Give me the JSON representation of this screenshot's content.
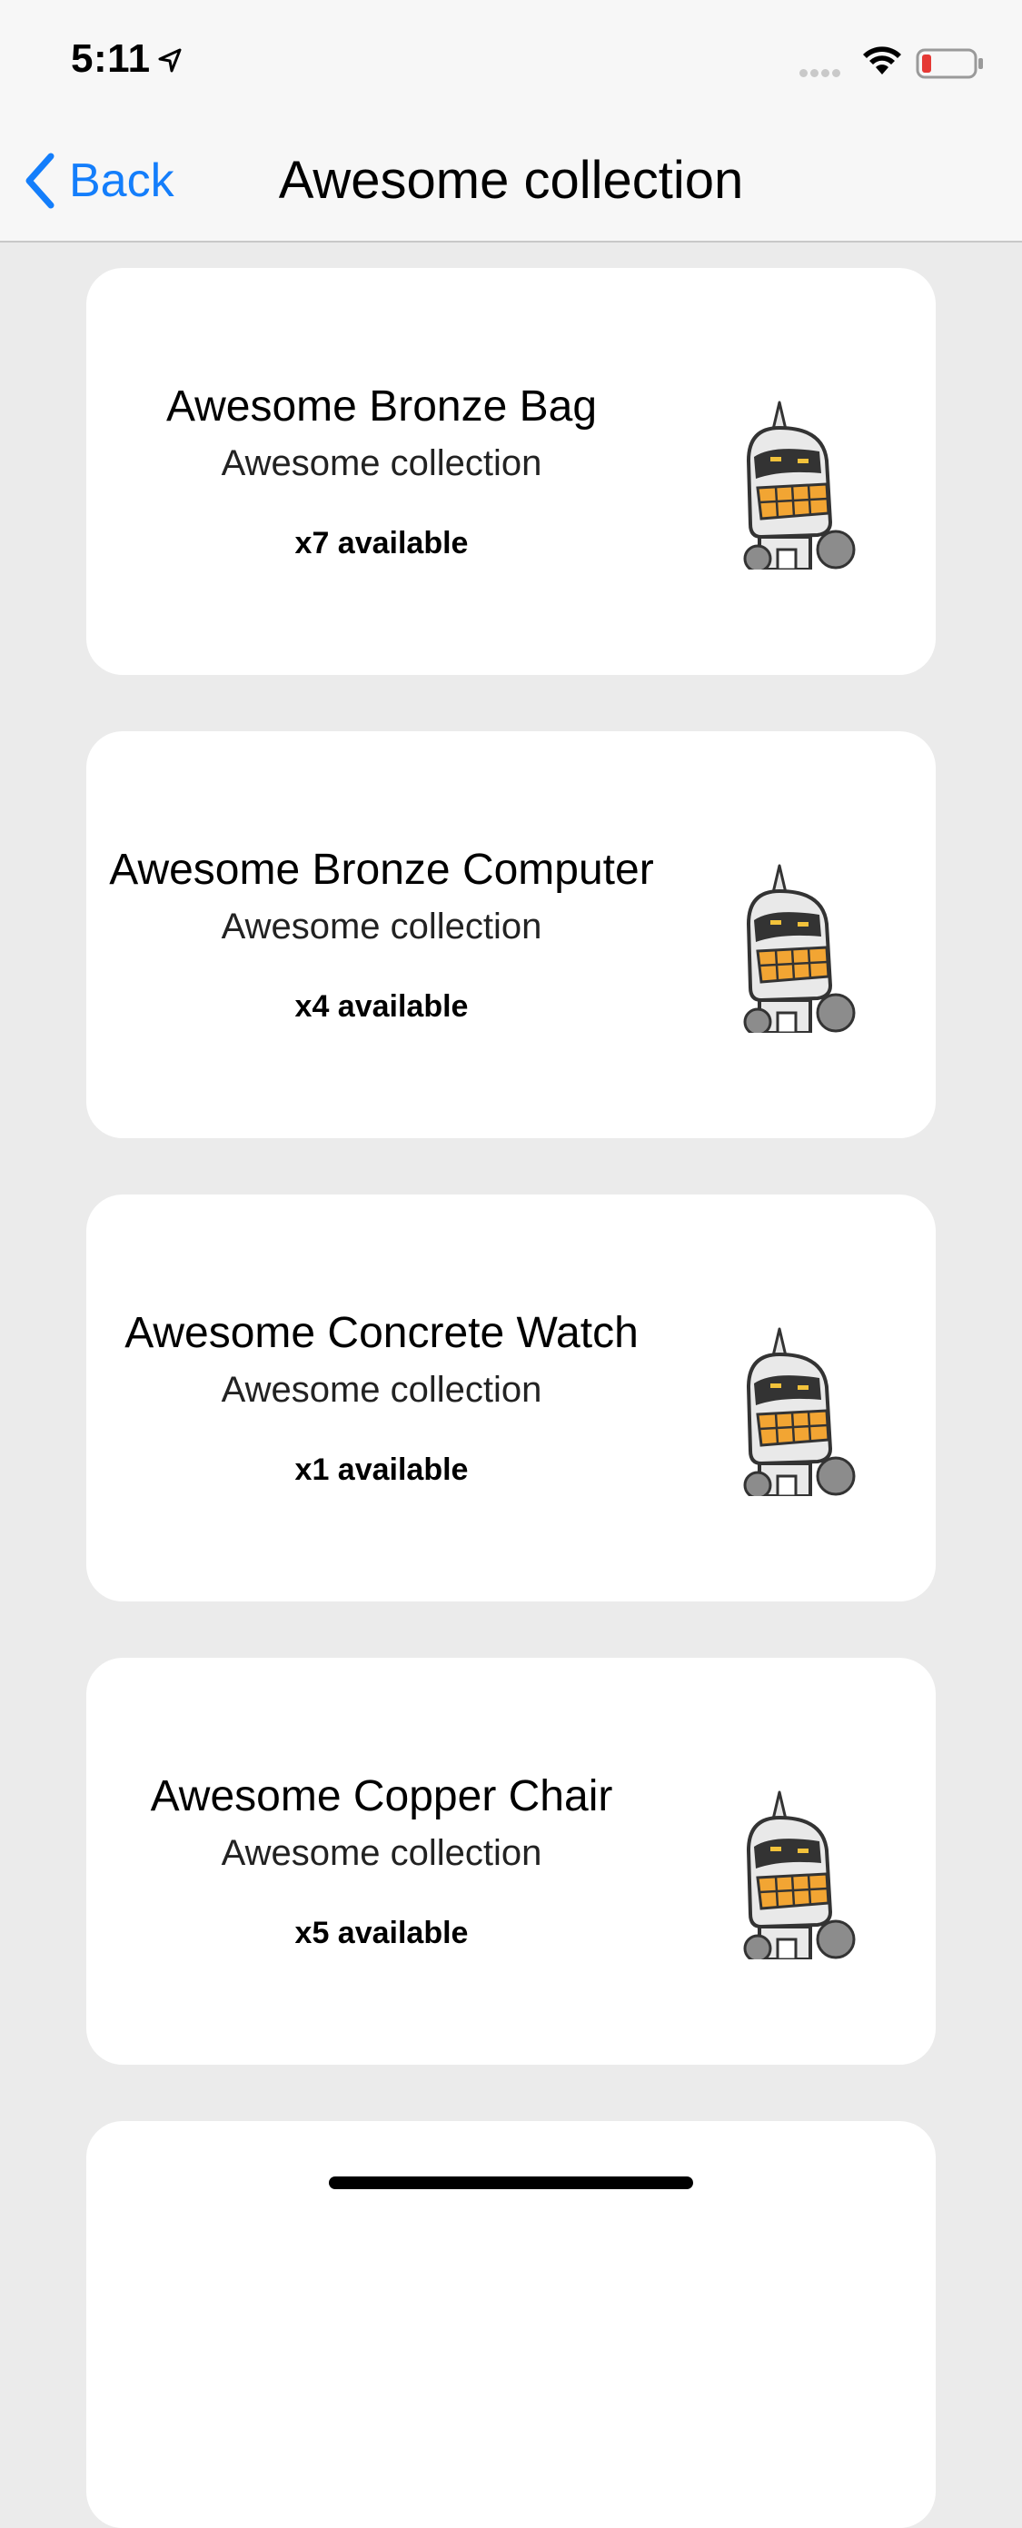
{
  "status_bar": {
    "time": "5:11",
    "icons": [
      "location-arrow-icon",
      "signal-dots-icon",
      "wifi-icon",
      "battery-low-icon"
    ],
    "battery_color": "#e53935"
  },
  "nav": {
    "back_label": "Back",
    "title": "Awesome collection",
    "accent": "#147efb"
  },
  "items": [
    {
      "title": "Awesome Bronze Bag",
      "subtitle": "Awesome collection",
      "available": "x7 available",
      "image": "robot-icon"
    },
    {
      "title": "Awesome Bronze Computer",
      "subtitle": "Awesome collection",
      "available": "x4 available",
      "image": "robot-icon"
    },
    {
      "title": "Awesome Concrete Watch",
      "subtitle": "Awesome collection",
      "available": "x1 available",
      "image": "robot-icon"
    },
    {
      "title": "Awesome Copper Chair",
      "subtitle": "Awesome collection",
      "available": "x5 available",
      "image": "robot-icon"
    }
  ]
}
